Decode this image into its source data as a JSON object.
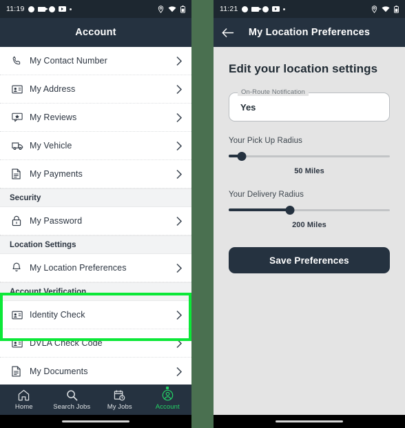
{
  "left_phone": {
    "status_bar": {
      "time": "11:19",
      "icons": [
        "circle-icon",
        "camcorder-icon",
        "circle-icon",
        "video-icon",
        "dot-icon"
      ],
      "right_icons": [
        "location-pin-icon",
        "wifi-icon",
        "battery-icon"
      ]
    },
    "app_bar": {
      "title": "Account"
    },
    "sections": [
      {
        "header": null,
        "rows": [
          {
            "label": "My Contact Number",
            "icon": "phone-icon"
          },
          {
            "label": "My Address",
            "icon": "id-card-icon"
          },
          {
            "label": "My Reviews",
            "icon": "review-icon"
          },
          {
            "label": "My Vehicle",
            "icon": "truck-icon"
          },
          {
            "label": "My Payments",
            "icon": "document-icon"
          }
        ]
      },
      {
        "header": "Security",
        "rows": [
          {
            "label": "My Password",
            "icon": "lock-icon"
          }
        ]
      },
      {
        "header": "Location Settings",
        "highlighted": true,
        "rows": [
          {
            "label": "My Location Preferences",
            "icon": "bell-icon"
          }
        ]
      },
      {
        "header": "Account Verification",
        "rows": [
          {
            "label": "Identity Check",
            "icon": "id-card-icon"
          },
          {
            "label": "DVLA Check Code",
            "icon": "id-card-icon"
          },
          {
            "label": "My Documents",
            "icon": "document-icon"
          }
        ]
      }
    ],
    "bottom_nav": [
      {
        "label": "Home",
        "icon": "home-icon",
        "active": false
      },
      {
        "label": "Search Jobs",
        "icon": "search-icon",
        "active": false
      },
      {
        "label": "My Jobs",
        "icon": "calendar-clock-icon",
        "active": false
      },
      {
        "label": "Account",
        "icon": "account-icon",
        "active": true
      }
    ],
    "highlight_color": "#0ce838"
  },
  "right_phone": {
    "status_bar": {
      "time": "11:21",
      "icons": [
        "circle-icon",
        "camcorder-icon",
        "circle-icon",
        "video-icon",
        "dot-icon"
      ],
      "right_icons": [
        "location-pin-icon",
        "wifi-icon",
        "battery-icon"
      ]
    },
    "app_bar": {
      "title": "My Location Preferences",
      "back_icon": "back-arrow-icon"
    },
    "page_title": "Edit your location settings",
    "notification_field": {
      "label": "On-Route Notification",
      "value": "Yes"
    },
    "pickup_slider": {
      "label": "Your Pick Up Radius",
      "value_text": "50 Miles",
      "percent": 8
    },
    "delivery_slider": {
      "label": "Your Delivery Radius",
      "value_text": "200 Miles",
      "percent": 38
    },
    "save_button": "Save Preferences"
  },
  "colors": {
    "divider_green": "#4a7050",
    "appbar": "#253240",
    "statusbar": "#1d2730",
    "accent_green": "#25d366",
    "highlight": "#0ce838"
  }
}
